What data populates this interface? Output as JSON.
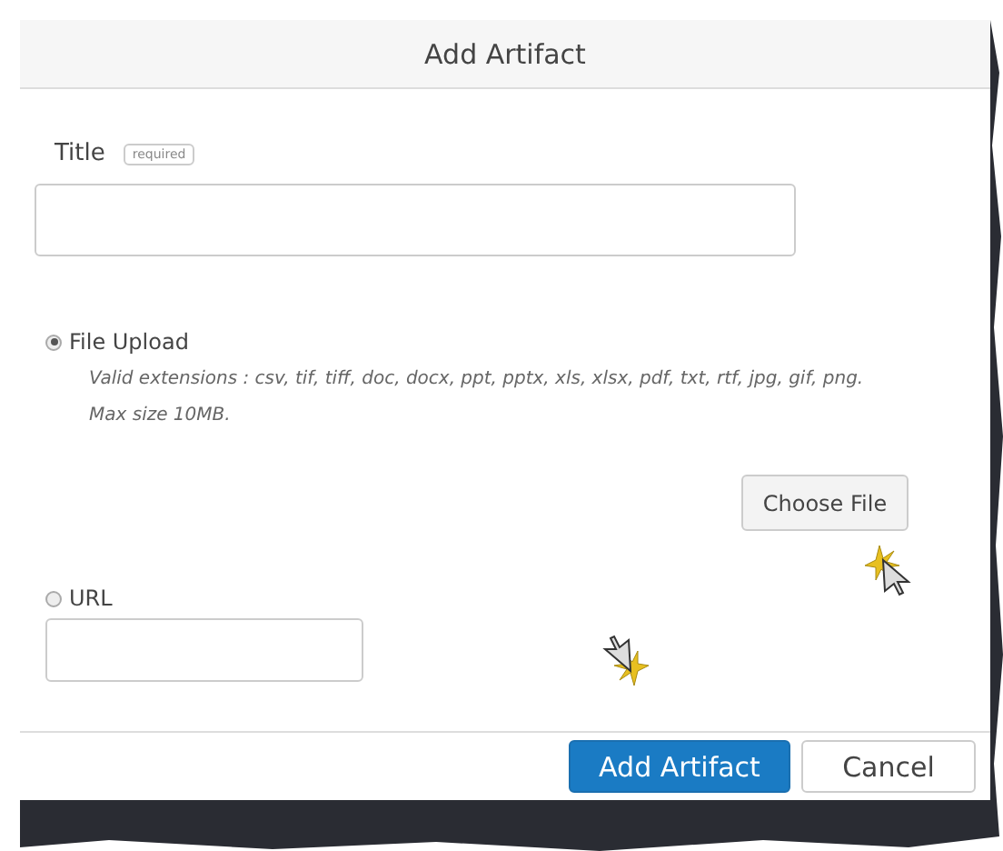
{
  "dialog": {
    "title": "Add Artifact"
  },
  "title_field": {
    "label": "Title",
    "badge": "required"
  },
  "sources": [
    {
      "kind": "file",
      "label": "File Upload",
      "selected": true,
      "notes": [
        "Valid extensions : csv, tif, tiff, doc, docx, ppt, pptx, xls, xlsx, pdf, txt, rtf, jpg, gif, png.",
        "Max size 10MB."
      ],
      "button": "Choose File"
    },
    {
      "kind": "url",
      "label": "URL",
      "selected": false
    }
  ],
  "buttons": [
    {
      "label": "Add Artifact",
      "kind": "primary"
    },
    {
      "label": "Cancel",
      "kind": "secondary"
    }
  ]
}
